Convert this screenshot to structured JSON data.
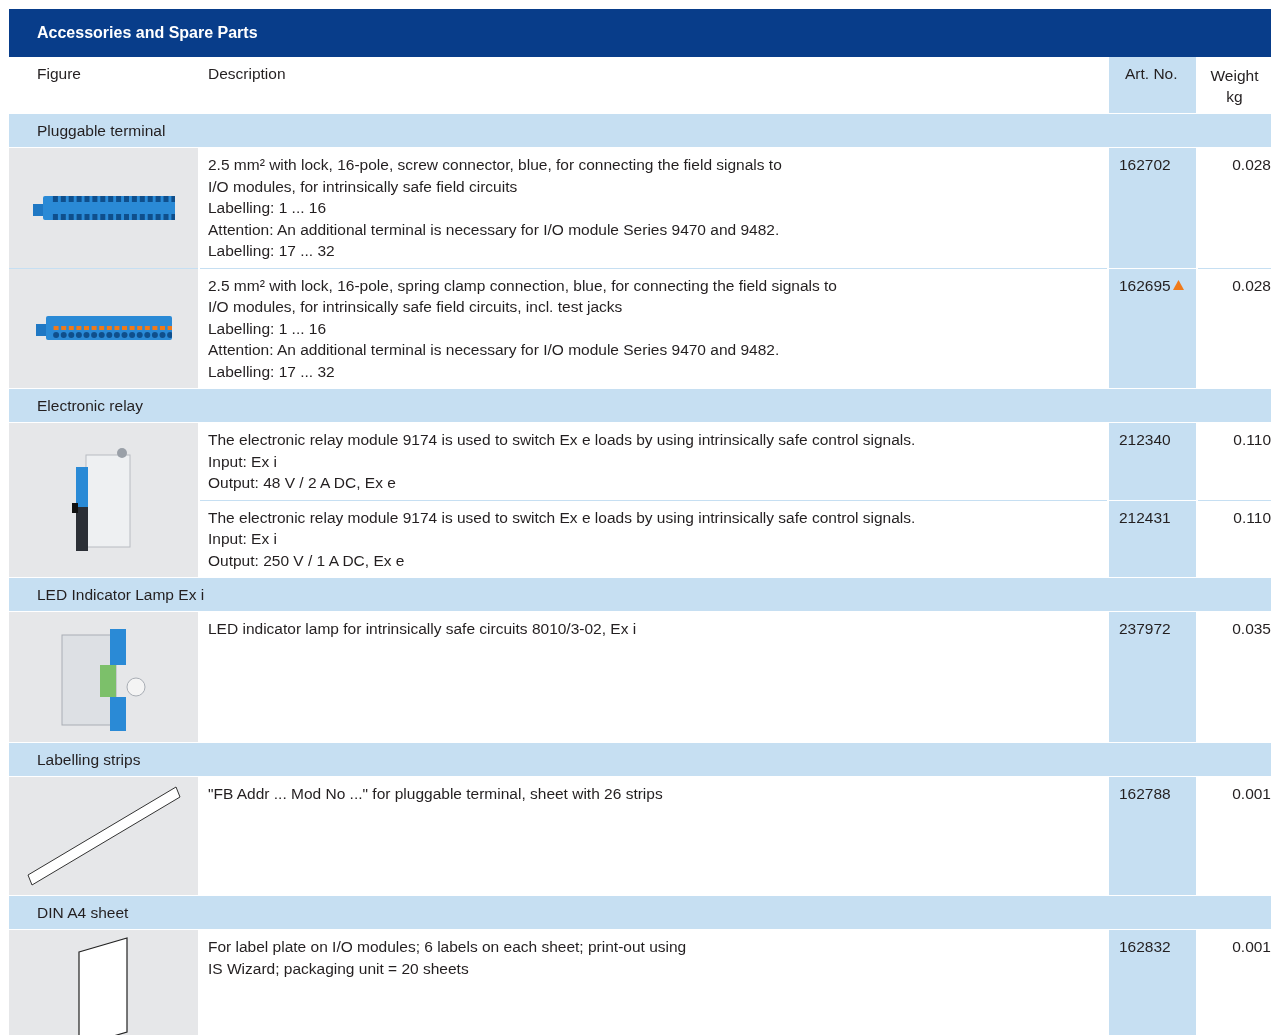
{
  "title": "Accessories and Spare Parts",
  "columns": {
    "figure": "Figure",
    "description": "Description",
    "art_no": "Art. No.",
    "weight": "Weight\nkg"
  },
  "groups": [
    {
      "title": "Pluggable terminal",
      "figures": [
        {
          "kind": "screw-terminal"
        },
        {
          "kind": "spring-terminal"
        }
      ],
      "items": [
        {
          "description": "2.5 mm² with lock, 16-pole, screw connector, blue, for connecting the field signals to\nI/O modules, for intrinsically safe field circuits\nLabelling: 1 ... 16\nAttention: An additional terminal is necessary for I/O module Series 9470 and 9482.\nLabelling: 17 ... 32",
          "art_no": "162702",
          "flagged": false,
          "weight": "0.028"
        },
        {
          "description": "2.5 mm² with lock, 16-pole, spring clamp connection, blue, for connecting the field signals to\nI/O modules, for intrinsically safe field circuits, incl. test jacks\nLabelling: 1 ... 16\nAttention: An additional terminal is necessary for I/O module Series 9470 and 9482.\nLabelling: 17 ... 32",
          "art_no": "162695",
          "flagged": true,
          "weight": "0.028"
        }
      ]
    },
    {
      "title": "Electronic relay",
      "figures": [
        {
          "kind": "relay"
        }
      ],
      "items": [
        {
          "description": "The electronic relay module 9174 is used to switch Ex e loads by using intrinsically safe control signals.\nInput: Ex i\nOutput: 48 V / 2 A DC, Ex e",
          "art_no": "212340",
          "flagged": false,
          "weight": "0.110"
        },
        {
          "description": "The electronic relay module 9174 is used to switch Ex e loads by using intrinsically safe control signals.\nInput: Ex i\nOutput: 250 V / 1 A DC, Ex e",
          "art_no": "212431",
          "flagged": false,
          "weight": "0.110"
        }
      ]
    },
    {
      "title": "LED Indicator Lamp Ex i",
      "figures": [
        {
          "kind": "lamp"
        }
      ],
      "items": [
        {
          "description": "LED indicator lamp for intrinsically safe circuits 8010/3-02, Ex i",
          "art_no": "237972",
          "flagged": false,
          "weight": "0.035"
        }
      ]
    },
    {
      "title": "Labelling strips",
      "figures": [
        {
          "kind": "strip"
        }
      ],
      "items": [
        {
          "description": "\"FB Addr ... Mod No ...\" for pluggable terminal, sheet with 26 strips",
          "art_no": "162788",
          "flagged": false,
          "weight": "0.001"
        }
      ]
    },
    {
      "title": "DIN A4 sheet",
      "figures": [
        {
          "kind": "sheet"
        }
      ],
      "items": [
        {
          "description": "For label plate on I/O modules; 6 labels on each sheet; print-out using\nIS Wizard; packaging unit = 20 sheets",
          "art_no": "162832",
          "flagged": false,
          "weight": "0.001"
        }
      ]
    }
  ]
}
